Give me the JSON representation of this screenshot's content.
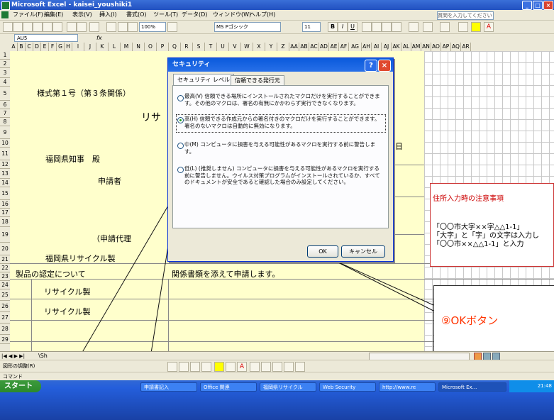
{
  "window": {
    "title": "Microsoft Excel - kaisei_youshiki1"
  },
  "menubar": {
    "items": [
      "ファイル(F)",
      "編集(E)",
      "表示(V)",
      "挿入(I)",
      "書式(O)",
      "ツール(T)",
      "データ(D)",
      "ウィンドウ(W)",
      "ヘルプ(H)"
    ],
    "help_placeholder": "質問を入力してください"
  },
  "toolbar": {
    "zoom": "100%",
    "font_name": "MS Pゴシック",
    "font_size": "11"
  },
  "formula_bar": {
    "name_box": "AU5",
    "fx": "fx"
  },
  "columns": [
    "A",
    "B",
    "C",
    "D",
    "E",
    "F",
    "G",
    "H",
    "I",
    "J",
    "K",
    "L",
    "M",
    "N",
    "O",
    "P",
    "Q",
    "R",
    "S",
    "T",
    "U",
    "V",
    "W",
    "X",
    "Y",
    "Z",
    "AA",
    "AB",
    "AC",
    "AD",
    "AE",
    "AF",
    "AG",
    "AH",
    "AI",
    "AJ",
    "AK",
    "AL",
    "AM",
    "AN",
    "AO",
    "AP",
    "AQ",
    "AR"
  ],
  "rows": [
    "1",
    "2",
    "3",
    "4",
    "5",
    "6",
    "7",
    "8",
    "9",
    "10",
    "11",
    "12",
    "13",
    "14",
    "15",
    "16",
    "17",
    "18",
    "19",
    "20",
    "21",
    "22",
    "23",
    "24",
    "25",
    "26",
    "27",
    "28",
    "29"
  ],
  "sheet": {
    "form_title": "様式第１号（第３条関係）",
    "recycle_head": "リサ",
    "prefecture_to": "福岡県知事　殿",
    "day": "日",
    "applicant": "申請者",
    "agent": "（申請代理",
    "recycle_prefix": "福岡県リサイクル製",
    "sentence_a": "製品の認定について",
    "sentence_b": "関係書類を添えて申請します。",
    "item1": "リサイクル製",
    "item2": "リサイクル製"
  },
  "notice": {
    "title": "住所入力時の注意事項",
    "line1": "「〇〇市大字××字△△1-1」",
    "line2": "「大字」と「字」の文字は入力し",
    "line3": "「〇〇市××△△1-1」と入力"
  },
  "dialog": {
    "title": "セキュリティ",
    "help_label": "?",
    "close_label": "×",
    "tabs": [
      "セキュリティ レベル",
      "信頼できる発行元"
    ],
    "options": [
      {
        "label": "最高(V)",
        "text": "最高(V)  信頼できる場所にインストールされたマクロだけを実行することができます。その他のマクロは、署名の有無にかかわらず実行できなくなります。",
        "checked": false
      },
      {
        "label": "高(H)",
        "text": "高(H)  信頼できる作成元からの署名付きのマクロだけを実行することができます。署名のないマクロは自動的に無効になります。",
        "checked": true
      },
      {
        "label": "中(M)",
        "text": "中(M)  コンピュータに損害を与える可能性があるマクロを実行する前に警告します。",
        "checked": false
      },
      {
        "label": "低(L)",
        "text": "低(L)  (推奨しません) コンピュータに損害を与える可能性があるマクロを実行する前に警告しません。ウイルス対策プログラムがインストールされているか、すべてのドキュメントが安全であると確認した場合のみ設定してください。",
        "checked": false
      }
    ],
    "ok_label": "OK",
    "cancel_label": "キャンセル"
  },
  "callout": {
    "text": "⑨OKボタン"
  },
  "sheet_tabs": {
    "nav": "|◀ ◀ ▶ ▶|",
    "first": "\\Sh"
  },
  "draw_toolbar": {
    "label": "図形の調整(R)"
  },
  "statusbar": {
    "text": "コマンド"
  },
  "taskbar": {
    "start": "スタート",
    "tasks": [
      "申請書記入",
      "Office 関連",
      "福岡県リサイクル",
      "Web Security",
      "http://www.re",
      "Microsoft Ex..."
    ],
    "clock": "21:48"
  },
  "colors": {
    "sheet_bg": "#ffffcc",
    "callout_text": "#ff3300",
    "dialog_title": "#0a5adc"
  }
}
